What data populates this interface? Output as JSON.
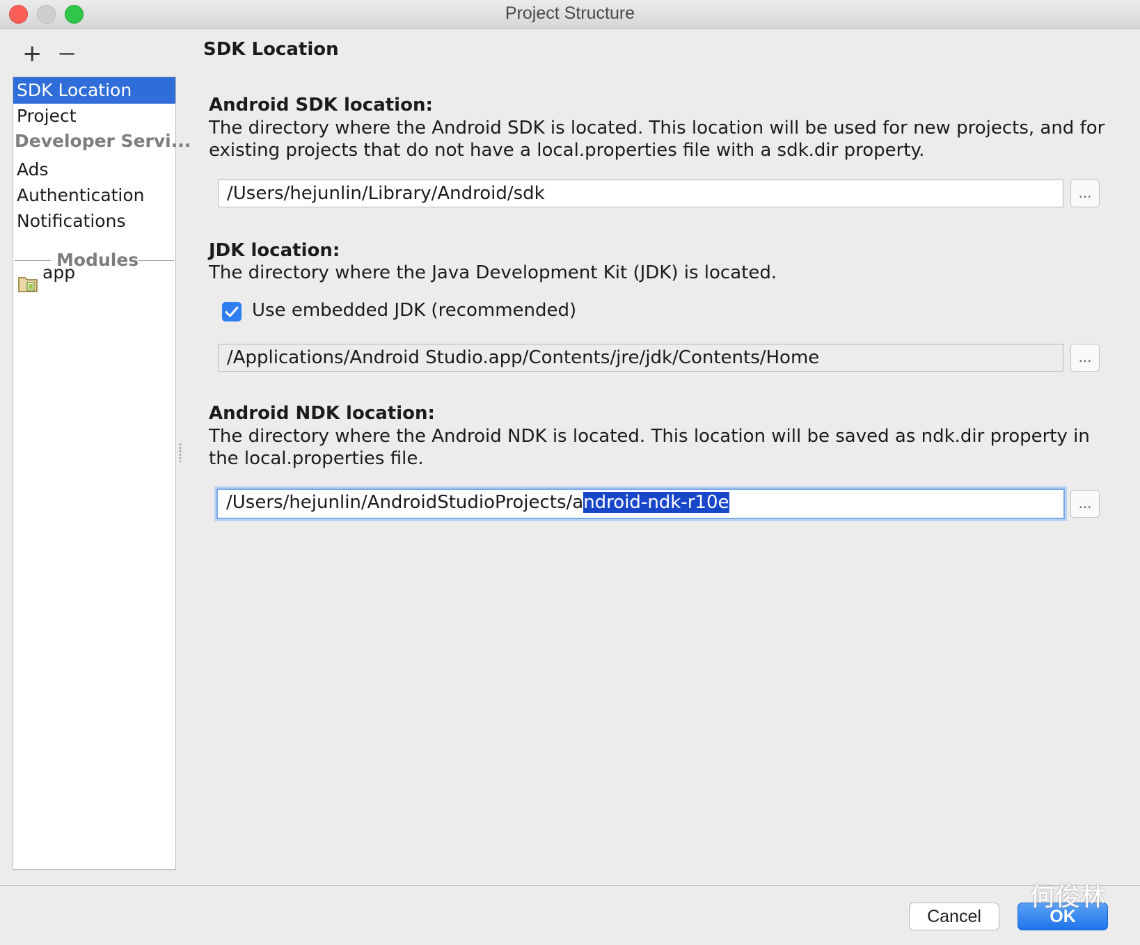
{
  "window": {
    "title": "Project Structure"
  },
  "toolbar": {
    "add_label": "+",
    "remove_label": "−"
  },
  "sidebar": {
    "items": [
      {
        "label": "SDK Location",
        "selected": true
      },
      {
        "label": "Project"
      }
    ],
    "developer_header": "Developer Servi...",
    "developer_items": [
      {
        "label": "Ads"
      },
      {
        "label": "Authentication"
      },
      {
        "label": "Notifications"
      }
    ],
    "modules_header": "Modules",
    "modules": [
      {
        "label": "app",
        "icon": "module-folder-icon"
      }
    ]
  },
  "main": {
    "page_title": "SDK Location",
    "sdk": {
      "title": "Android SDK location:",
      "desc": "The directory where the Android SDK is located. This location will be used for new projects, and for existing projects that do not have a local.properties file with a sdk.dir property.",
      "path": "/Users/hejunlin/Library/Android/sdk",
      "browse_label": "..."
    },
    "jdk": {
      "title": "JDK location:",
      "desc": "The directory where the Java Development Kit (JDK) is located.",
      "checkbox_label": "Use embedded JDK (recommended)",
      "checkbox_checked": true,
      "path": "/Applications/Android Studio.app/Contents/jre/jdk/Contents/Home",
      "browse_label": "..."
    },
    "ndk": {
      "title": "Android NDK location:",
      "desc": "The directory where the Android NDK is located. This location will be saved as ndk.dir property in the local.properties file.",
      "path_prefix": "/Users/hejunlin/AndroidStudioProjects/a",
      "path_selected": "ndroid-ndk-r10e",
      "browse_label": "..."
    }
  },
  "footer": {
    "cancel_label": "Cancel",
    "ok_label": "OK"
  },
  "watermark": {
    "text": "何俊林"
  },
  "colors": {
    "selection": "#2f6ed8",
    "text_selection": "#1947c9",
    "accent": "#2f7ff2"
  }
}
